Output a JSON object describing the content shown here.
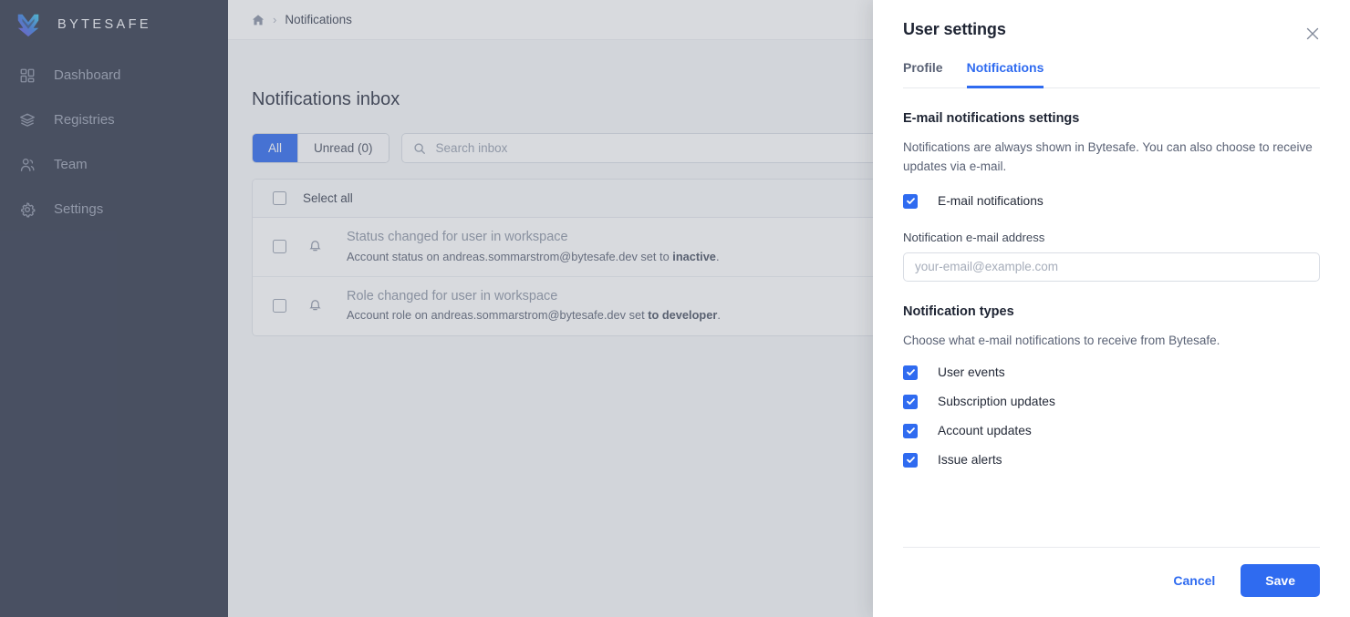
{
  "sidebar": {
    "brand": "BYTESAFE",
    "logo_icon": "bytesafe-logo-icon",
    "items": [
      {
        "label": "Dashboard",
        "icon": "grid-icon"
      },
      {
        "label": "Registries",
        "icon": "layers-icon"
      },
      {
        "label": "Team",
        "icon": "users-icon"
      },
      {
        "label": "Settings",
        "icon": "gear-icon"
      }
    ]
  },
  "topbar": {
    "home_icon": "home-icon",
    "separator": "›",
    "breadcrumb": "Notifications"
  },
  "main": {
    "page_title": "Notifications inbox",
    "filters": [
      {
        "label": "All",
        "active": true
      },
      {
        "label": "Unread (0)",
        "active": false
      }
    ],
    "search": {
      "placeholder": "Search inbox",
      "value": "",
      "icon": "search-icon"
    },
    "list": {
      "select_all_label": "Select all",
      "rows": [
        {
          "icon": "bell-icon",
          "title": "Status changed for user in workspace",
          "detail_prefix": "Account status on andreas.sommarstrom@bytesafe.dev set to ",
          "detail_strong": "inactive",
          "detail_suffix": "."
        },
        {
          "icon": "bell-icon",
          "title": "Role changed for user in workspace",
          "detail_prefix": "Account role on andreas.sommarstrom@bytesafe.dev set ",
          "detail_strong": "to developer",
          "detail_suffix": "."
        }
      ]
    }
  },
  "panel": {
    "title": "User settings",
    "close_icon": "close-icon",
    "tabs": [
      {
        "label": "Profile",
        "active": false
      },
      {
        "label": "Notifications",
        "active": true
      }
    ],
    "email_section": {
      "heading": "E-mail notifications settings",
      "description": "Notifications are always shown in Bytesafe. You can also choose to receive updates via e-mail.",
      "toggle_label": "E-mail notifications",
      "toggle_checked": true,
      "field_label": "Notification e-mail address",
      "field_placeholder": "your-email@example.com",
      "field_value": ""
    },
    "types_section": {
      "heading": "Notification types",
      "description": "Choose what e-mail notifications to receive from Bytesafe.",
      "options": [
        {
          "label": "User events",
          "checked": true
        },
        {
          "label": "Subscription updates",
          "checked": true
        },
        {
          "label": "Account updates",
          "checked": true
        },
        {
          "label": "Issue alerts",
          "checked": true
        }
      ]
    },
    "footer": {
      "cancel_label": "Cancel",
      "save_label": "Save"
    }
  },
  "colors": {
    "accent": "#2f6bf0",
    "sidebar_bg": "#333a4d",
    "panel_bg": "#ffffff",
    "text_primary": "#1e2433",
    "text_muted": "#5a6275"
  }
}
